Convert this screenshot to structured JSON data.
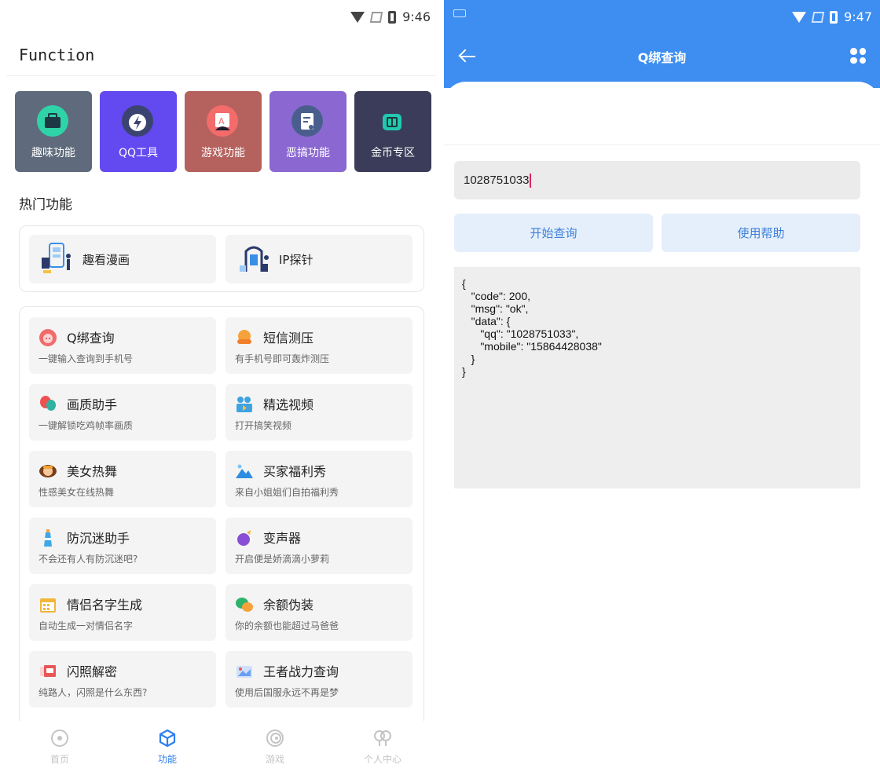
{
  "left": {
    "status": {
      "time": "9:46"
    },
    "app_title": "Function",
    "categories": [
      {
        "label": "趣味功能",
        "color": "#5f6b7c",
        "icon": "briefcase-icon",
        "icon_color": "#2fd3a8"
      },
      {
        "label": "QQ工具",
        "color": "#6349f0",
        "icon": "lightning-icon",
        "icon_color": "#3b4470"
      },
      {
        "label": "游戏功能",
        "color": "#b5625e",
        "icon": "game-board-icon",
        "icon_color": "#f46b6b"
      },
      {
        "label": "恶搞功能",
        "color": "#8b68d1",
        "icon": "notepad-icon",
        "icon_color": "#4a5e8e"
      },
      {
        "label": "金币专区",
        "color": "#3a3c59",
        "icon": "book-icon",
        "icon_color": "#22c9b0"
      }
    ],
    "hot_section_title": "热门功能",
    "hot_items": [
      {
        "label": "趣看漫画",
        "icon": "comic-illustration-icon"
      },
      {
        "label": "IP探针",
        "icon": "ip-probe-illustration-icon"
      }
    ],
    "features": [
      {
        "name": "Q绑查询",
        "desc": "一键输入查询到手机号",
        "icon": "pig-icon",
        "color": "#f26b6b"
      },
      {
        "name": "短信测压",
        "desc": "有手机号即可轰炸测压",
        "icon": "sofa-icon",
        "color": "#f5a23a"
      },
      {
        "name": "画质助手",
        "desc": "一键解锁吃鸡帧率画质",
        "icon": "balloon-icon",
        "color": "#ef5050"
      },
      {
        "name": "精选视频",
        "desc": "打开搞笑视频",
        "icon": "video-people-icon",
        "color": "#3fa3e0"
      },
      {
        "name": "美女热舞",
        "desc": "性感美女在线热舞",
        "icon": "girl-icon",
        "color": "#f2a531"
      },
      {
        "name": "买家福利秀",
        "desc": "来自小姐姐们自拍福利秀",
        "icon": "mountain-image-icon",
        "color": "#2e8de0"
      },
      {
        "name": "防沉迷助手",
        "desc": "不会还有人有防沉迷吧?",
        "icon": "lighthouse-icon",
        "color": "#3da8e8"
      },
      {
        "name": "变声器",
        "desc": "开启便是娇滴滴小萝莉",
        "icon": "eggplant-icon",
        "color": "#8a4dd6"
      },
      {
        "name": "情侣名字生成",
        "desc": "自动生成一对情侣名字",
        "icon": "calendar-icon",
        "color": "#f2b53a"
      },
      {
        "name": "余额伪装",
        "desc": "你的余额也能超过马爸爸",
        "icon": "chat-bubbles-icon",
        "color": "#2fb36b"
      },
      {
        "name": "闪照解密",
        "desc": "纯路人，闪照是什么东西?",
        "icon": "photo-card-icon",
        "color": "#e85757"
      },
      {
        "name": "王者战力查询",
        "desc": "使用后国服永远不再是梦",
        "icon": "game-card-icon",
        "color": "#6a9ff0"
      }
    ],
    "bottom_nav": [
      {
        "label": "首页",
        "icon": "home-circle-icon",
        "active": false
      },
      {
        "label": "功能",
        "icon": "cube-icon",
        "active": true
      },
      {
        "label": "游戏",
        "icon": "spiral-icon",
        "active": false
      },
      {
        "label": "个人中心",
        "icon": "people-icon",
        "active": false
      }
    ]
  },
  "right": {
    "status": {
      "time": "9:47"
    },
    "header_title": "Q绑查询",
    "input_value": "1028751033",
    "buttons": {
      "query": "开始查询",
      "help": "使用帮助"
    },
    "result_text": "{\n   \"code\": 200,\n   \"msg\": \"ok\",\n   \"data\": {\n      \"qq\": \"1028751033\",\n      \"mobile\": \"15864428038\"\n   }\n}",
    "accent_color": "#3d8ef0"
  }
}
